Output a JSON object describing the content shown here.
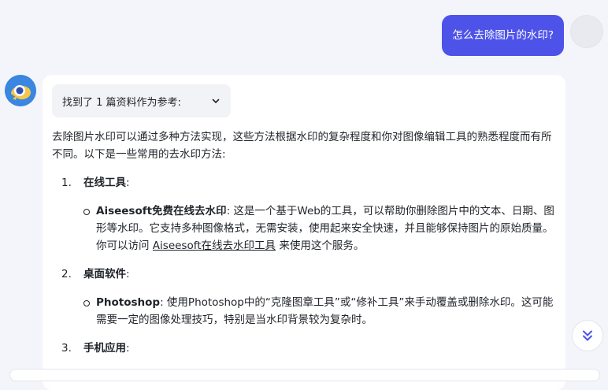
{
  "user_message": "怎么去除图片的水印?",
  "references": {
    "label": "找到了 1 篇资料作为参考:"
  },
  "answer": {
    "intro": "去除图片水印可以通过多种方法实现，这些方法根据水印的复杂程度和你对图像编辑工具的熟悉程度而有所不同。以下是一些常用的去水印方法:",
    "sections": [
      {
        "num": "1.",
        "title": "在线工具",
        "colon": ":",
        "bullet_title": "Aiseesoft免费在线去水印",
        "bullet_pre": ": 这是一个基于Web的工具，可以帮助你删除图片中的文本、日期、图形等水印。它支持多种图像格式，无需安装，使用起来安全快速，并且能够保持图片的原始质量。你可以访问 ",
        "bullet_link": "Aiseesoft在线去水印工具",
        "bullet_post": " 来使用这个服务。"
      },
      {
        "num": "2.",
        "title": "桌面软件",
        "colon": ":",
        "bullet_title": "Photoshop",
        "bullet_text": ": 使用Photoshop中的“克隆图章工具”或“修补工具”来手动覆盖或删除水印。这可能需要一定的图像处理技巧，特别是当水印背景较为复杂时。"
      },
      {
        "num": "3.",
        "title": "手机应用",
        "colon": ":"
      }
    ]
  },
  "icons": {
    "refs_toggle": "chevron-down-icon",
    "scroll": "double-chevron-down-icon",
    "bot": "bot-avatar-icon"
  },
  "colors": {
    "user_bubble": "#4d53e8",
    "background": "#f4f5fb"
  }
}
